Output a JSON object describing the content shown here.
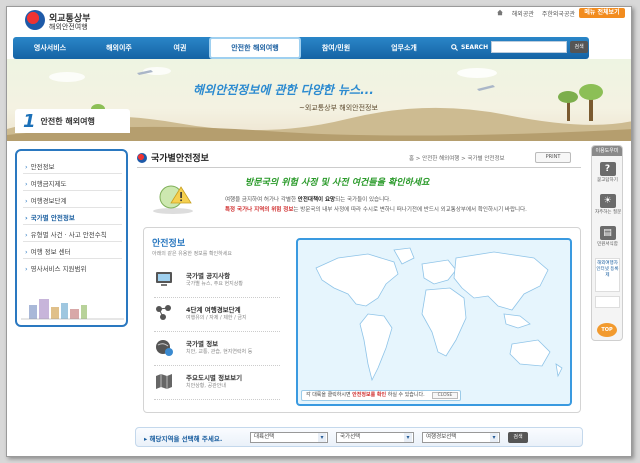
{
  "header": {
    "logo_title": "외교통상부",
    "logo_subtitle": "해외안전여행",
    "util_links": [
      "해외공관",
      "주한외국공관"
    ],
    "menu_all": "메뉴 전체보기"
  },
  "gnb": {
    "items": [
      "영사서비스",
      "해외이주",
      "여권",
      "안전한 해외여행",
      "참여/민원",
      "업무소개"
    ],
    "active_index": 3,
    "search_label": "SEARCH",
    "search_placeholder": "",
    "search_button": "검색"
  },
  "banner": {
    "title": "해외안전정보에 관한 다양한 뉴스...",
    "subtitle": "~외교통상부 해외안전정보",
    "page_number": "1",
    "page_name": "안전한 해외여행"
  },
  "lnb": {
    "items": [
      "안전정보",
      "여행금지제도",
      "여행경보단계",
      "국가별 안전정보",
      "유형별 사건 · 사고 안전수칙",
      "여행 정보 센터",
      "영사서비스 지원범위"
    ],
    "active_index": 3
  },
  "content": {
    "title": "국가별안전정보",
    "breadcrumb": "홈 > 안전한 해외여행 > 국가별 안전정보",
    "print": "PRINT",
    "intro_script": "방문국의 위험 사정 및 사전 여건들을 확인하세요",
    "intro_line1_pre": "여행을 금지하여 허가나 각별한 ",
    "intro_line1_bold": "안전대책이 요망",
    "intro_line1_post": "되는 국가들이 있습니다.",
    "intro_line2_red": "특정 국가나 지역의 위험 정보",
    "intro_line2_post": "는 방문국의 내부 사정에 따라 수시로 변하니 떠나기전에 반드시 외교통상부에서 확인하시기 바랍니다."
  },
  "info": {
    "heading": "안전정보",
    "subheading": "아래의 같은 유용한 정보를 확인하세요",
    "items": [
      {
        "title": "국가별 공지사항",
        "desc": "국가별 뉴스, 주요 현지상황",
        "icon": "monitor-icon"
      },
      {
        "title": "4단계 여행경보단계",
        "desc": "여행유의 / 자제 / 제한 / 금지",
        "icon": "alert-stages-icon"
      },
      {
        "title": "국가별 정보",
        "desc": "치안, 교통, 관습, 현지연락처 등",
        "icon": "globe-info-icon"
      },
      {
        "title": "주요도시별 정보보기",
        "desc": "치안상황, 공관안내",
        "icon": "city-map-icon"
      }
    ],
    "map_notice_pre": "각 대륙을 클릭하시면 ",
    "map_notice_highlight": "안전정보를 확인",
    "map_notice_post": " 하실 수 있습니다.",
    "map_close": "CLOSE"
  },
  "region": {
    "label": "해당지역을 선택해 주세요.",
    "selects": [
      "대륙선택",
      "국가선택",
      "여행경보선택"
    ],
    "button": "검색"
  },
  "quick": {
    "heading": "이용도우미",
    "items": [
      {
        "label": "묻고답하기",
        "icon": "question-icon",
        "glyph": "?"
      },
      {
        "label": "자주하는 질문",
        "icon": "lightbulb-icon",
        "glyph": "☀"
      },
      {
        "label": "민원서식함",
        "icon": "form-icon",
        "glyph": "▤"
      }
    ],
    "banner_text": "해외여행자 인터넷 등록제",
    "top": "TOP"
  },
  "colors": {
    "gnb": "#1f74b8",
    "accent_orange": "#f28c1f",
    "map_land": "#ffffff",
    "map_sea": "#e6f5fd",
    "intro_green": "#2a9a2a"
  }
}
